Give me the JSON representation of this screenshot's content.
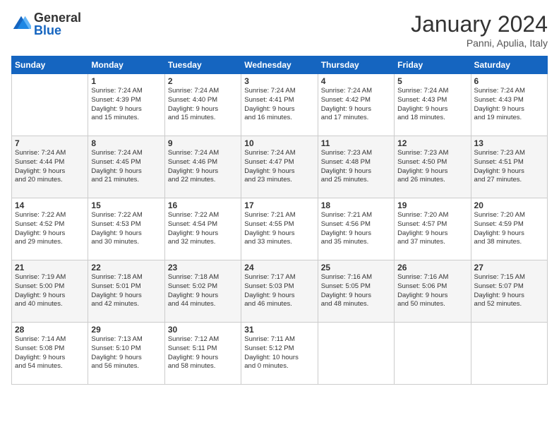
{
  "logo": {
    "general": "General",
    "blue": "Blue"
  },
  "title": "January 2024",
  "subtitle": "Panni, Apulia, Italy",
  "header_days": [
    "Sunday",
    "Monday",
    "Tuesday",
    "Wednesday",
    "Thursday",
    "Friday",
    "Saturday"
  ],
  "weeks": [
    [
      {
        "day": "",
        "info": ""
      },
      {
        "day": "1",
        "info": "Sunrise: 7:24 AM\nSunset: 4:39 PM\nDaylight: 9 hours\nand 15 minutes."
      },
      {
        "day": "2",
        "info": "Sunrise: 7:24 AM\nSunset: 4:40 PM\nDaylight: 9 hours\nand 15 minutes."
      },
      {
        "day": "3",
        "info": "Sunrise: 7:24 AM\nSunset: 4:41 PM\nDaylight: 9 hours\nand 16 minutes."
      },
      {
        "day": "4",
        "info": "Sunrise: 7:24 AM\nSunset: 4:42 PM\nDaylight: 9 hours\nand 17 minutes."
      },
      {
        "day": "5",
        "info": "Sunrise: 7:24 AM\nSunset: 4:43 PM\nDaylight: 9 hours\nand 18 minutes."
      },
      {
        "day": "6",
        "info": "Sunrise: 7:24 AM\nSunset: 4:43 PM\nDaylight: 9 hours\nand 19 minutes."
      }
    ],
    [
      {
        "day": "7",
        "info": "Sunrise: 7:24 AM\nSunset: 4:44 PM\nDaylight: 9 hours\nand 20 minutes."
      },
      {
        "day": "8",
        "info": "Sunrise: 7:24 AM\nSunset: 4:45 PM\nDaylight: 9 hours\nand 21 minutes."
      },
      {
        "day": "9",
        "info": "Sunrise: 7:24 AM\nSunset: 4:46 PM\nDaylight: 9 hours\nand 22 minutes."
      },
      {
        "day": "10",
        "info": "Sunrise: 7:24 AM\nSunset: 4:47 PM\nDaylight: 9 hours\nand 23 minutes."
      },
      {
        "day": "11",
        "info": "Sunrise: 7:23 AM\nSunset: 4:48 PM\nDaylight: 9 hours\nand 25 minutes."
      },
      {
        "day": "12",
        "info": "Sunrise: 7:23 AM\nSunset: 4:50 PM\nDaylight: 9 hours\nand 26 minutes."
      },
      {
        "day": "13",
        "info": "Sunrise: 7:23 AM\nSunset: 4:51 PM\nDaylight: 9 hours\nand 27 minutes."
      }
    ],
    [
      {
        "day": "14",
        "info": "Sunrise: 7:22 AM\nSunset: 4:52 PM\nDaylight: 9 hours\nand 29 minutes."
      },
      {
        "day": "15",
        "info": "Sunrise: 7:22 AM\nSunset: 4:53 PM\nDaylight: 9 hours\nand 30 minutes."
      },
      {
        "day": "16",
        "info": "Sunrise: 7:22 AM\nSunset: 4:54 PM\nDaylight: 9 hours\nand 32 minutes."
      },
      {
        "day": "17",
        "info": "Sunrise: 7:21 AM\nSunset: 4:55 PM\nDaylight: 9 hours\nand 33 minutes."
      },
      {
        "day": "18",
        "info": "Sunrise: 7:21 AM\nSunset: 4:56 PM\nDaylight: 9 hours\nand 35 minutes."
      },
      {
        "day": "19",
        "info": "Sunrise: 7:20 AM\nSunset: 4:57 PM\nDaylight: 9 hours\nand 37 minutes."
      },
      {
        "day": "20",
        "info": "Sunrise: 7:20 AM\nSunset: 4:59 PM\nDaylight: 9 hours\nand 38 minutes."
      }
    ],
    [
      {
        "day": "21",
        "info": "Sunrise: 7:19 AM\nSunset: 5:00 PM\nDaylight: 9 hours\nand 40 minutes."
      },
      {
        "day": "22",
        "info": "Sunrise: 7:18 AM\nSunset: 5:01 PM\nDaylight: 9 hours\nand 42 minutes."
      },
      {
        "day": "23",
        "info": "Sunrise: 7:18 AM\nSunset: 5:02 PM\nDaylight: 9 hours\nand 44 minutes."
      },
      {
        "day": "24",
        "info": "Sunrise: 7:17 AM\nSunset: 5:03 PM\nDaylight: 9 hours\nand 46 minutes."
      },
      {
        "day": "25",
        "info": "Sunrise: 7:16 AM\nSunset: 5:05 PM\nDaylight: 9 hours\nand 48 minutes."
      },
      {
        "day": "26",
        "info": "Sunrise: 7:16 AM\nSunset: 5:06 PM\nDaylight: 9 hours\nand 50 minutes."
      },
      {
        "day": "27",
        "info": "Sunrise: 7:15 AM\nSunset: 5:07 PM\nDaylight: 9 hours\nand 52 minutes."
      }
    ],
    [
      {
        "day": "28",
        "info": "Sunrise: 7:14 AM\nSunset: 5:08 PM\nDaylight: 9 hours\nand 54 minutes."
      },
      {
        "day": "29",
        "info": "Sunrise: 7:13 AM\nSunset: 5:10 PM\nDaylight: 9 hours\nand 56 minutes."
      },
      {
        "day": "30",
        "info": "Sunrise: 7:12 AM\nSunset: 5:11 PM\nDaylight: 9 hours\nand 58 minutes."
      },
      {
        "day": "31",
        "info": "Sunrise: 7:11 AM\nSunset: 5:12 PM\nDaylight: 10 hours\nand 0 minutes."
      },
      {
        "day": "",
        "info": ""
      },
      {
        "day": "",
        "info": ""
      },
      {
        "day": "",
        "info": ""
      }
    ]
  ]
}
